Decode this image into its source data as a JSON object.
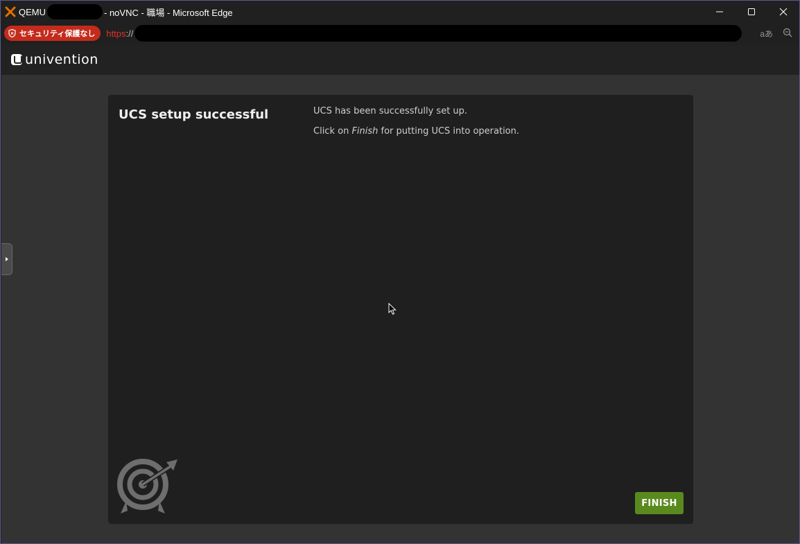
{
  "window": {
    "title_prefix": "QEMU",
    "title_suffix": "- noVNC - 職場 - Microsoft Edge",
    "controls": {
      "minimize": "—",
      "maximize": "☐",
      "close": "✕"
    }
  },
  "addressbar": {
    "security_label": "セキュリティ保護なし",
    "url_scheme": "https",
    "url_separator": "://",
    "read_aloud_icon": "aあ",
    "zoom_icon": "⊖"
  },
  "ucs": {
    "logo_text": "univention"
  },
  "card": {
    "title": "UCS setup successful",
    "line1": "UCS has been successfully set up.",
    "line2_prefix": "Click on ",
    "line2_emph": "Finish",
    "line2_suffix": " for putting UCS into operation.",
    "finish_label": "FINISH"
  },
  "colors": {
    "security_badge": "#c42b1c",
    "finish_button": "#5a8a1e",
    "page_bg": "#333333",
    "card_bg": "#1f1f1f"
  }
}
